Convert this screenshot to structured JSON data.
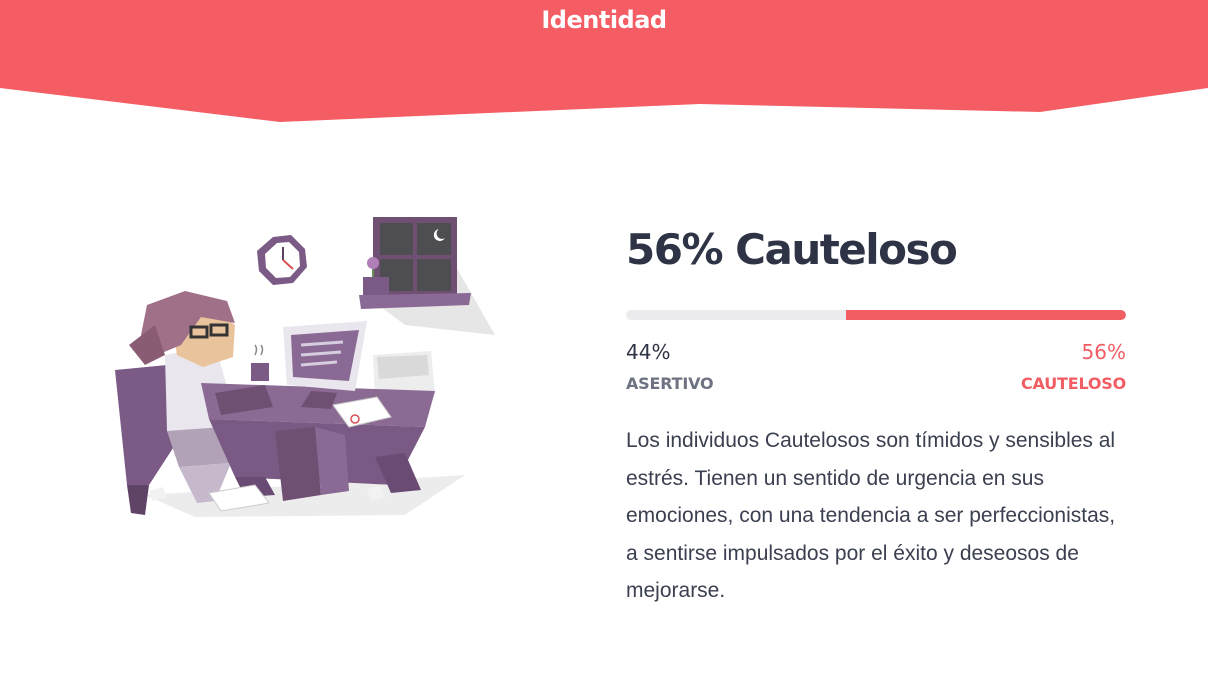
{
  "header": {
    "title": "Identidad",
    "color": "#f45d64"
  },
  "illustration": {
    "description_icon": "worried-person-at-desk-illustration"
  },
  "result": {
    "headline": "56% Cauteloso",
    "left_percent": "44%",
    "left_label": "ASERTIVO",
    "right_percent": "56%",
    "right_label": "CAUTELOSO",
    "right_fraction": 0.56,
    "accent_color": "#f15d63",
    "description": "Los individuos Cautelosos son tímidos y sensibles al estrés. Tienen un sentido de urgencia en sus emociones, con una tendencia a ser perfeccionistas, a sentirse impulsados por el éxito y deseosos de mejorarse."
  }
}
